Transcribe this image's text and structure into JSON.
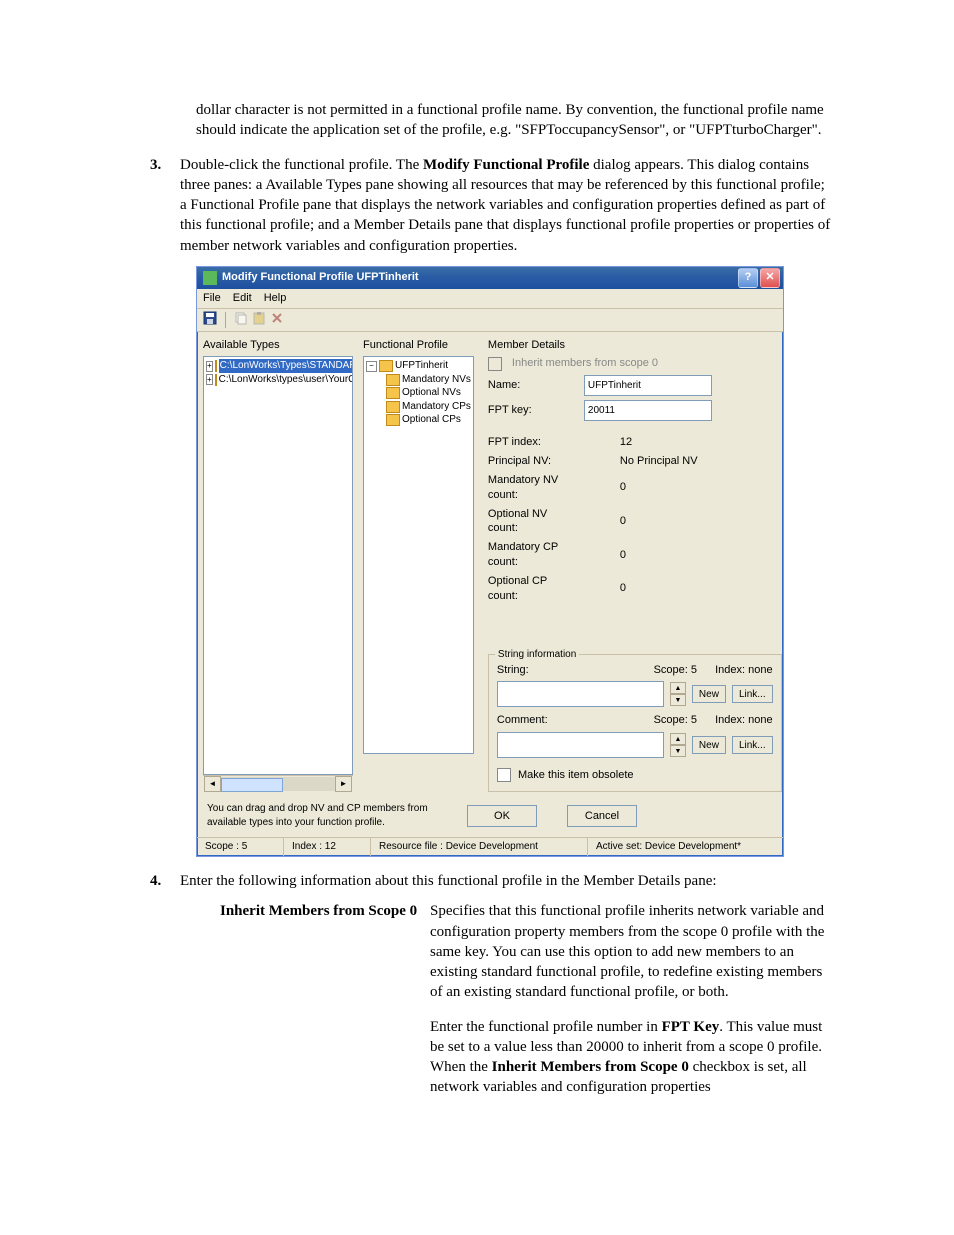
{
  "doc": {
    "intro_frag": "dollar character is not permitted in a functional profile name.  By convention, the functional profile name should indicate the application set of the profile, e.g. \"SFPToccupancySensor\", or \"UFPTturboCharger\".",
    "item3_a": "Double-click the functional profile.  The ",
    "item3_b": "Modify Functional Profile",
    "item3_c": " dialog appears.  This dialog contains three panes: a Available Types pane showing all resources that may be referenced by this functional profile; a Functional Profile pane that displays the network variables and configuration properties defined as part of this functional profile; and a Member Details pane that displays functional profile properties or properties of member network variables and configuration properties.",
    "item4": "Enter the following information about this functional profile in the Member Details pane:",
    "def_term": "Inherit Members from Scope 0",
    "def_p1": "Specifies that this functional profile inherits network variable and configuration property members from the scope 0 profile with the same key.  You can use this option to add new members to an existing standard functional profile, to redefine existing members of an existing standard functional profile, or both.",
    "def_p2_a": "Enter the functional profile number in ",
    "def_p2_b": "FPT Key",
    "def_p2_c": ".  This value must be set to a value less than 20000 to inherit from a scope 0 profile.  When the ",
    "def_p2_d": "Inherit Members from Scope 0",
    "def_p2_e": " checkbox is set, all network variables and configuration properties"
  },
  "dlg": {
    "title": "Modify Functional Profile UFPTinherit",
    "menus": [
      "File",
      "Edit",
      "Help"
    ],
    "pane_labels": {
      "left": "Available Types",
      "mid": "Functional Profile",
      "right": "Member Details"
    },
    "left_tree": {
      "n1": "C:\\LonWorks\\Types\\STANDAR",
      "n2": "C:\\LonWorks\\types\\user\\YourC"
    },
    "mid_tree": {
      "root": "UFPTinherit",
      "children": [
        "Mandatory NVs",
        "Optional NVs",
        "Mandatory CPs",
        "Optional CPs"
      ]
    },
    "details": {
      "inherit_label": "Inherit members from scope 0",
      "name_label": "Name:",
      "name_value": "UFPTinherit",
      "fptkey_label": "FPT key:",
      "fptkey_value": "20011",
      "rows": [
        {
          "l": "FPT index:",
          "v": "12"
        },
        {
          "l": "Principal NV:",
          "v": "No Principal NV"
        },
        {
          "l": "Mandatory NV count:",
          "v": "0"
        },
        {
          "l": "Optional NV count:",
          "v": "0"
        },
        {
          "l": "Mandatory CP count:",
          "v": "0"
        },
        {
          "l": "Optional CP count:",
          "v": "0"
        }
      ],
      "group_title": "String information",
      "string_label": "String:",
      "comment_label": "Comment:",
      "scope_text": "Scope: 5",
      "index_text": "Index: none",
      "new_btn": "New",
      "link_btn": "Link...",
      "obsolete_label": "Make this item obsolete"
    },
    "hint": "You can drag and drop NV and CP members from available types into your function profile.",
    "ok": "OK",
    "cancel": "Cancel",
    "status": {
      "scope": "Scope : 5",
      "index": "Index : 12",
      "resfile": "Resource file : Device Development",
      "activeset": "Active set: Device Development*"
    }
  }
}
